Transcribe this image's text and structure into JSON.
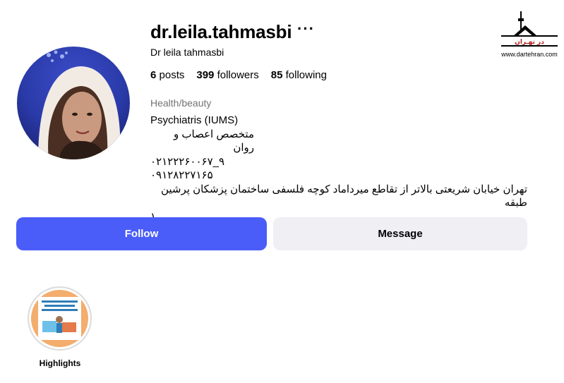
{
  "profile": {
    "username": "dr.leila.tahmasbi",
    "more_label": "···",
    "full_name": "Dr leila tahmasbi",
    "stats": {
      "posts_count": "6",
      "posts_label": "posts",
      "followers_count": "399",
      "followers_label": "followers",
      "following_count": "85",
      "following_label": "following"
    },
    "category": "Health/beauty",
    "bio_lines": [
      "Psychiatris (IUMS)",
      "متخصص اعصاب و روان",
      "۰۲۱۲۲۲۶۰۰۶۷_۹",
      "۰۹۱۲۸۲۲۷۱۶۵",
      "تهران خیابان شریعتی بالاتر از تقاطع میرداماد کوچه فلسفی ساختمان پزشکان پرشین طبقه",
      "۱"
    ]
  },
  "actions": {
    "follow_label": "Follow",
    "message_label": "Message"
  },
  "highlights": {
    "label": "Highlights"
  },
  "watermark": {
    "text": "در تهـران",
    "url": "www.dartehran.com"
  },
  "colors": {
    "follow_bg": "#4a5df9",
    "message_bg": "#efeff4",
    "category_text": "#737373"
  }
}
